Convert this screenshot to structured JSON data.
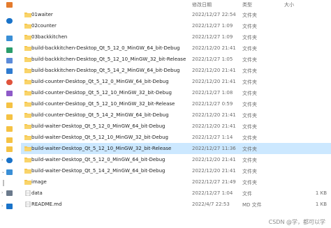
{
  "header": {
    "date_modified": "修改日期",
    "type": "类型",
    "size": "大小"
  },
  "sidebar": {
    "icons": [
      "home-icon",
      "cloud-icon",
      "monitor-icon",
      "download-icon",
      "document-icon",
      "picture-icon",
      "music-icon",
      "video-icon",
      "folder-icon",
      "folder-icon",
      "folder-icon",
      "folder-icon",
      "folder-icon",
      "folder-icon",
      "cloud-icon",
      "pc-icon",
      "drive-icon",
      "network-icon"
    ]
  },
  "files": [
    {
      "name": "01waiter",
      "date": "2022/12/27 22:54",
      "type": "文件夹",
      "size": "",
      "icon": "folder-icon"
    },
    {
      "name": "02counter",
      "date": "2022/12/27 1:09",
      "type": "文件夹",
      "size": "",
      "icon": "folder-icon"
    },
    {
      "name": "03backkitchen",
      "date": "2022/12/27 1:09",
      "type": "文件夹",
      "size": "",
      "icon": "folder-icon"
    },
    {
      "name": "build-backkitchen-Desktop_Qt_5_12_0_MinGW_64_bit-Debug",
      "date": "2022/12/20 21:41",
      "type": "文件夹",
      "size": "",
      "icon": "folder-icon"
    },
    {
      "name": "build-backkitchen-Desktop_Qt_5_12_10_MinGW_32_bit-Release",
      "date": "2022/12/27 1:05",
      "type": "文件夹",
      "size": "",
      "icon": "folder-icon"
    },
    {
      "name": "build-backkitchen-Desktop_Qt_5_14_2_MinGW_64_bit-Debug",
      "date": "2022/12/20 21:41",
      "type": "文件夹",
      "size": "",
      "icon": "folder-icon"
    },
    {
      "name": "build-counter-Desktop_Qt_5_12_0_MinGW_64_bit-Debug",
      "date": "2022/12/20 21:41",
      "type": "文件夹",
      "size": "",
      "icon": "folder-icon"
    },
    {
      "name": "build-counter-Desktop_Qt_5_12_10_MinGW_32_bit-Debug",
      "date": "2022/12/27 1:08",
      "type": "文件夹",
      "size": "",
      "icon": "folder-icon"
    },
    {
      "name": "build-counter-Desktop_Qt_5_12_10_MinGW_32_bit-Release",
      "date": "2022/12/27 0:59",
      "type": "文件夹",
      "size": "",
      "icon": "folder-icon"
    },
    {
      "name": "build-counter-Desktop_Qt_5_14_2_MinGW_64_bit-Debug",
      "date": "2022/12/20 21:41",
      "type": "文件夹",
      "size": "",
      "icon": "folder-icon"
    },
    {
      "name": "build-waiter-Desktop_Qt_5_12_0_MinGW_64_bit-Debug",
      "date": "2022/12/20 21:41",
      "type": "文件夹",
      "size": "",
      "icon": "folder-icon"
    },
    {
      "name": "build-waiter-Desktop_Qt_5_12_10_MinGW_32_bit-Debug",
      "date": "2022/12/27 1:14",
      "type": "文件夹",
      "size": "",
      "icon": "folder-icon"
    },
    {
      "name": "build-waiter-Desktop_Qt_5_12_10_MinGW_32_bit-Release",
      "date": "2022/12/27 11:36",
      "type": "文件夹",
      "size": "",
      "icon": "folder-icon",
      "selected": true
    },
    {
      "name": "build-waiter-Desktop_Qt_5_12_0_MinGW_64_bit-Debug",
      "date": "2022/12/20 21:41",
      "type": "文件夹",
      "size": "",
      "icon": "folder-icon"
    },
    {
      "name": "build-waiter-Desktop_Qt_5_14_2_MinGW_64_bit-Debug",
      "date": "2022/12/20 21:41",
      "type": "文件夹",
      "size": "",
      "icon": "folder-icon"
    },
    {
      "name": "image",
      "date": "2022/12/27 21:49",
      "type": "文件夹",
      "size": "",
      "icon": "folder-icon"
    },
    {
      "name": "data",
      "date": "2022/12/27 1:04",
      "type": "文件",
      "size": "1 KB",
      "icon": "file-icon"
    },
    {
      "name": "README.md",
      "date": "2022/4/7 22:53",
      "type": "MD 文件",
      "size": "1 KB",
      "icon": "markdown-file-icon"
    }
  ],
  "watermark": "CSDN @学，都可以学",
  "colors": {
    "selection": "#cce8ff",
    "folder": "#f5c243",
    "accent": "#1a73c9"
  }
}
